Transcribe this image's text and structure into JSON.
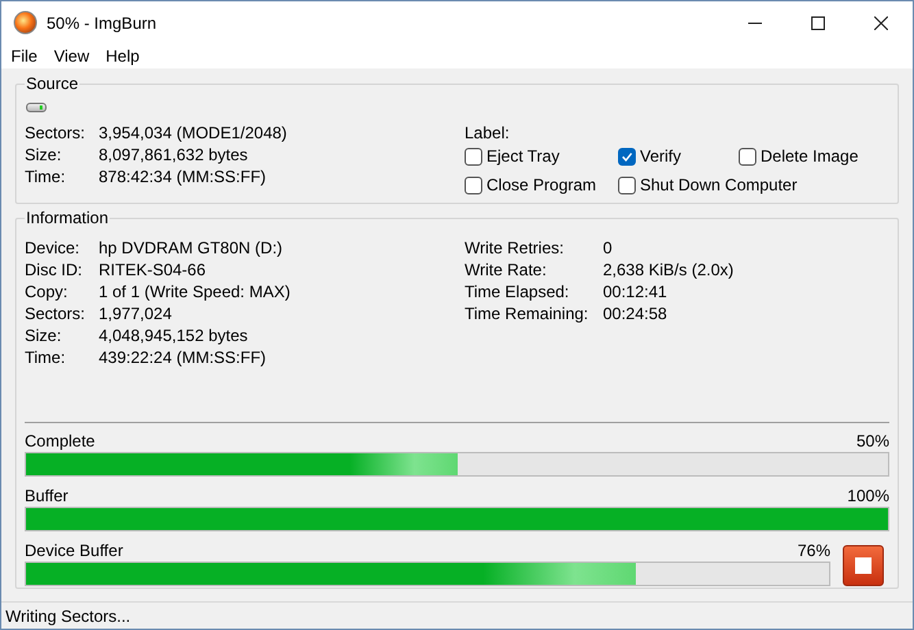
{
  "window": {
    "title": "50% - ImgBurn"
  },
  "menu": [
    "File",
    "View",
    "Help"
  ],
  "source": {
    "title": "Source",
    "fields": [
      {
        "label": "Sectors:",
        "value": "3,954,034 (MODE1/2048)"
      },
      {
        "label": "Size:",
        "value": "8,097,861,632 bytes"
      },
      {
        "label": "Time:",
        "value": "878:42:34 (MM:SS:FF)"
      }
    ],
    "label_caption": "Label:",
    "options": [
      {
        "label": "Eject Tray",
        "checked": false
      },
      {
        "label": "Verify",
        "checked": true
      },
      {
        "label": "Delete Image",
        "checked": false
      },
      {
        "label": "Close Program",
        "checked": false
      },
      {
        "label": "Shut Down Computer",
        "checked": false
      }
    ]
  },
  "information": {
    "title": "Information",
    "left": [
      {
        "label": "Device:",
        "value": "hp DVDRAM GT80N (D:)"
      },
      {
        "label": "Disc ID:",
        "value": "RITEK-S04-66"
      },
      {
        "label": "Copy:",
        "value": "1 of 1 (Write Speed: MAX)"
      },
      {
        "label": "Sectors:",
        "value": "1,977,024"
      },
      {
        "label": "Size:",
        "value": "4,048,945,152 bytes"
      },
      {
        "label": "Time:",
        "value": "439:22:24 (MM:SS:FF)"
      }
    ],
    "right": [
      {
        "label": "Write Retries:",
        "value": "0"
      },
      {
        "label": "Write Rate:",
        "value": "2,638 KiB/s (2.0x)"
      },
      {
        "label": "Time Elapsed:",
        "value": "00:12:41"
      },
      {
        "label": "Time Remaining:",
        "value": "00:24:58"
      }
    ],
    "progress": [
      {
        "label": "Complete",
        "reading": "50%",
        "level": 0.5
      },
      {
        "label": "Buffer",
        "reading": "100%",
        "level": 1
      },
      {
        "label": "Device Buffer",
        "reading": "76%",
        "level": 0.76
      }
    ]
  },
  "status_bar": "Writing Sectors..."
}
